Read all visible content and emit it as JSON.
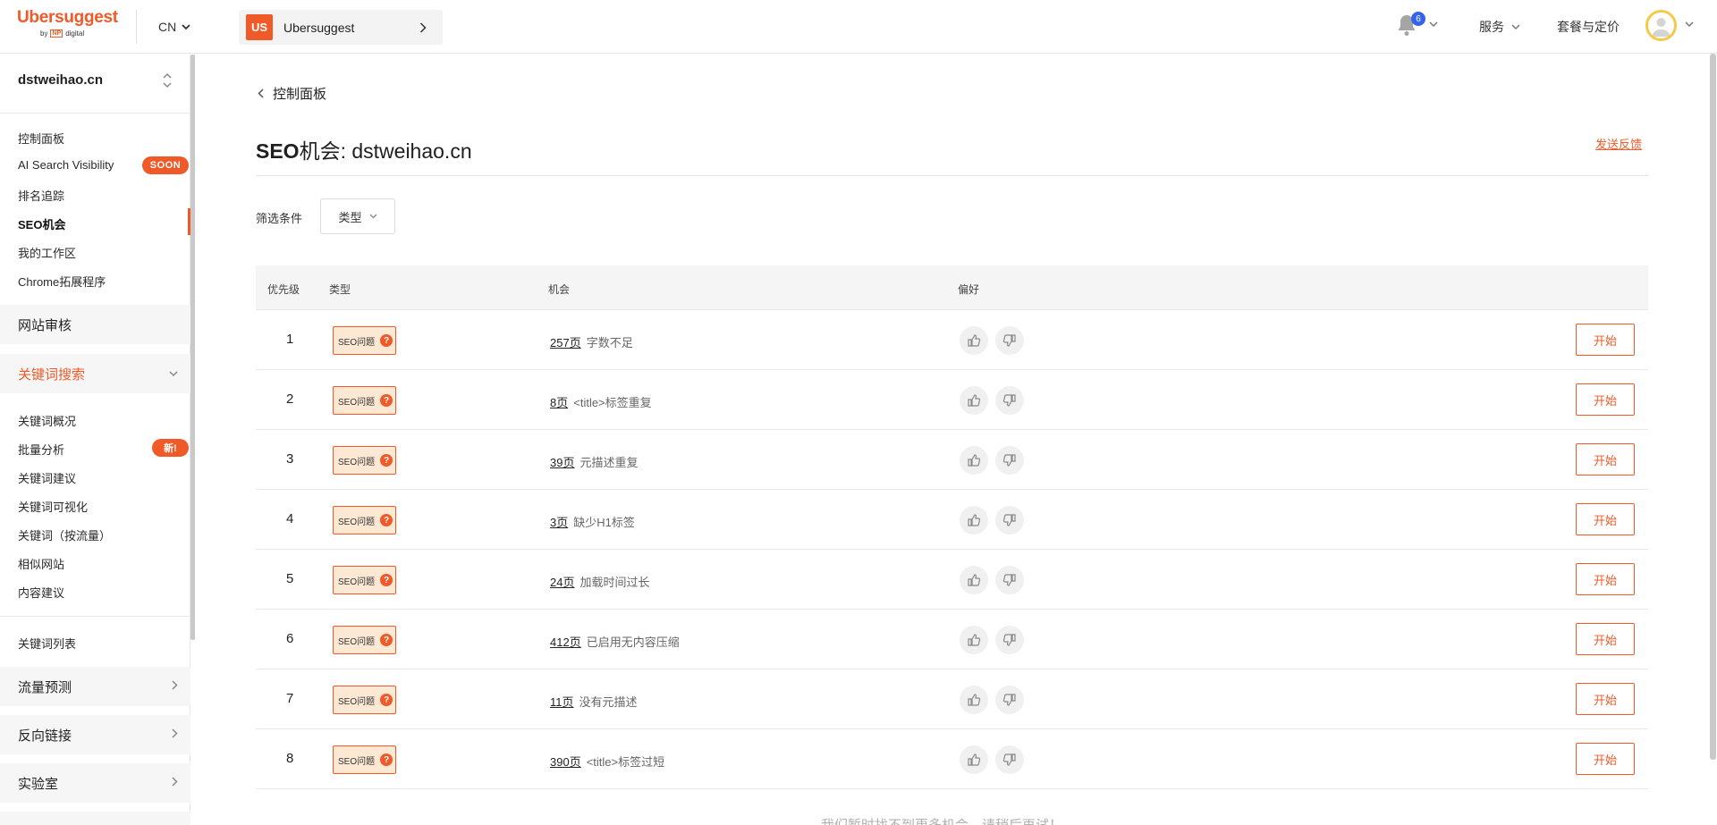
{
  "header": {
    "brand": "Ubersuggest",
    "brand_by": "by",
    "brand_np": "NP",
    "brand_digital": "digital",
    "lang": "CN",
    "project_initials": "US",
    "project_name": "Ubersuggest",
    "notification_count": "6",
    "nav_services": "服务",
    "nav_pricing": "套餐与定价"
  },
  "sidebar": {
    "domain": "dstweihao.cn",
    "group1": [
      {
        "label": "控制面板"
      },
      {
        "label": "AI Search Visibility",
        "badge": "SOON"
      },
      {
        "label": "排名追踪"
      },
      {
        "label": "SEO机会",
        "active": true
      },
      {
        "label": "我的工作区"
      },
      {
        "label": "Chrome拓展程序"
      }
    ],
    "section_audit": "网站审核",
    "section_keywords": "关键词搜索",
    "group2": [
      {
        "label": "关键词概况"
      },
      {
        "label": "批量分析",
        "badge": "新!"
      },
      {
        "label": "关键词建议"
      },
      {
        "label": "关键词可视化"
      },
      {
        "label": "关键词（按流量）"
      },
      {
        "label": "相似网站"
      },
      {
        "label": "内容建议"
      }
    ],
    "keyword_list": "关键词列表",
    "section_traffic": "流量预测",
    "section_backlinks": "反向链接",
    "section_labs": "实验室"
  },
  "main": {
    "back_label": "控制面板",
    "title_bold": "SEO",
    "title_rest": "机会: dstweihao.cn",
    "feedback": "发送反馈",
    "filter_label": "筛选条件",
    "filter_type": "类型",
    "columns": {
      "priority": "优先级",
      "type": "类型",
      "opportunity": "机会",
      "preference": "偏好"
    },
    "type_tag": "SEO问题",
    "start_label": "开始",
    "rows": [
      {
        "priority": "1",
        "count": "257页",
        "desc": "字数不足"
      },
      {
        "priority": "2",
        "count": "8页",
        "desc": "<title>标签重复"
      },
      {
        "priority": "3",
        "count": "39页",
        "desc": "元描述重复"
      },
      {
        "priority": "4",
        "count": "3页",
        "desc": "缺少H1标签"
      },
      {
        "priority": "5",
        "count": "24页",
        "desc": "加载时间过长"
      },
      {
        "priority": "6",
        "count": "412页",
        "desc": "已启用无内容压缩"
      },
      {
        "priority": "7",
        "count": "11页",
        "desc": "没有元描述"
      },
      {
        "priority": "8",
        "count": "390页",
        "desc": "<title>标签过短"
      }
    ],
    "bottom_note": "我们暂时找不到更多机会，请稍后再试！"
  },
  "colors": {
    "accent": "#f05a28",
    "tag_bg": "#fde8d4",
    "badge_blue": "#3563e9"
  }
}
